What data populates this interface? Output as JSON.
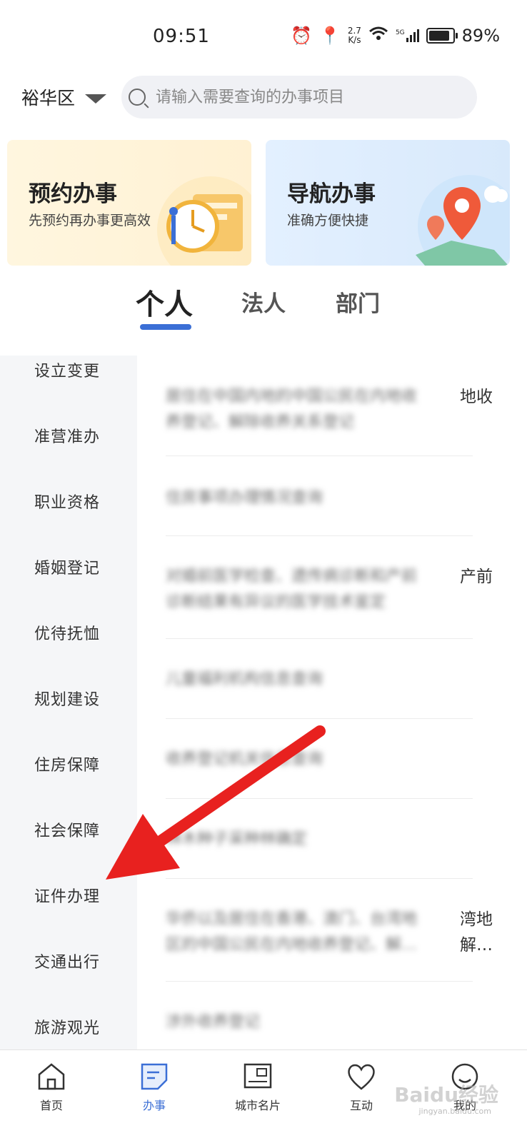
{
  "status": {
    "time": "09:51",
    "net_speed_value": "2.7",
    "net_speed_unit": "K/s",
    "battery": "89%",
    "signal_label": "5G"
  },
  "header": {
    "region": "裕华区",
    "search_placeholder": "请输入需要查询的办事项目"
  },
  "cards": [
    {
      "title": "预约办事",
      "subtitle": "先预约再办事更高效"
    },
    {
      "title": "导航办事",
      "subtitle": "准确方便快捷"
    }
  ],
  "tabs": [
    "个人",
    "法人",
    "部门"
  ],
  "sidebar": [
    "设立变更",
    "准营准办",
    "职业资格",
    "婚姻登记",
    "优待抚恤",
    "规划建设",
    "住房保障",
    "社会保障",
    "证件办理",
    "交通出行",
    "旅游观光"
  ],
  "items": [
    {
      "line1": "居住在中国内地的中国公民在内地收",
      "line2": "养登记、解除收养关系登记",
      "tail": "地收"
    },
    {
      "line1": "住房事项办理情况查询",
      "line2": "",
      "tail": ""
    },
    {
      "line1": "对婚前医学检查、遗传病诊断和产前",
      "line2": "诊断结果有异议的医学技术鉴定",
      "tail": "产前"
    },
    {
      "line1": "儿童福利机构信息查询",
      "line2": "",
      "tail": ""
    },
    {
      "line1": "收养登记机关信息查询",
      "line2": "",
      "tail": ""
    },
    {
      "line1": "林木种子采种林确定",
      "line2": "",
      "tail": ""
    },
    {
      "line1": "华侨以及居住在香港、澳门、台湾地",
      "line2": "区的中国公民在内地收养登记、解…",
      "tail": "湾地",
      "tail2": "解…"
    },
    {
      "line1": "涉外收养登记",
      "line2": "",
      "tail": ""
    }
  ],
  "nav": [
    {
      "label": "首页",
      "icon": "home-icon"
    },
    {
      "label": "办事",
      "icon": "document-icon"
    },
    {
      "label": "城市名片",
      "icon": "card-icon"
    },
    {
      "label": "互动",
      "icon": "heart-icon"
    },
    {
      "label": "我的",
      "icon": "user-icon"
    }
  ],
  "watermark": {
    "logo": "Baidu经验",
    "url": "jingyan.baidu.com"
  },
  "colors": {
    "accent": "#3b6fd6",
    "arrow": "#e8211f",
    "sidebar_bg": "#f5f6f8"
  }
}
